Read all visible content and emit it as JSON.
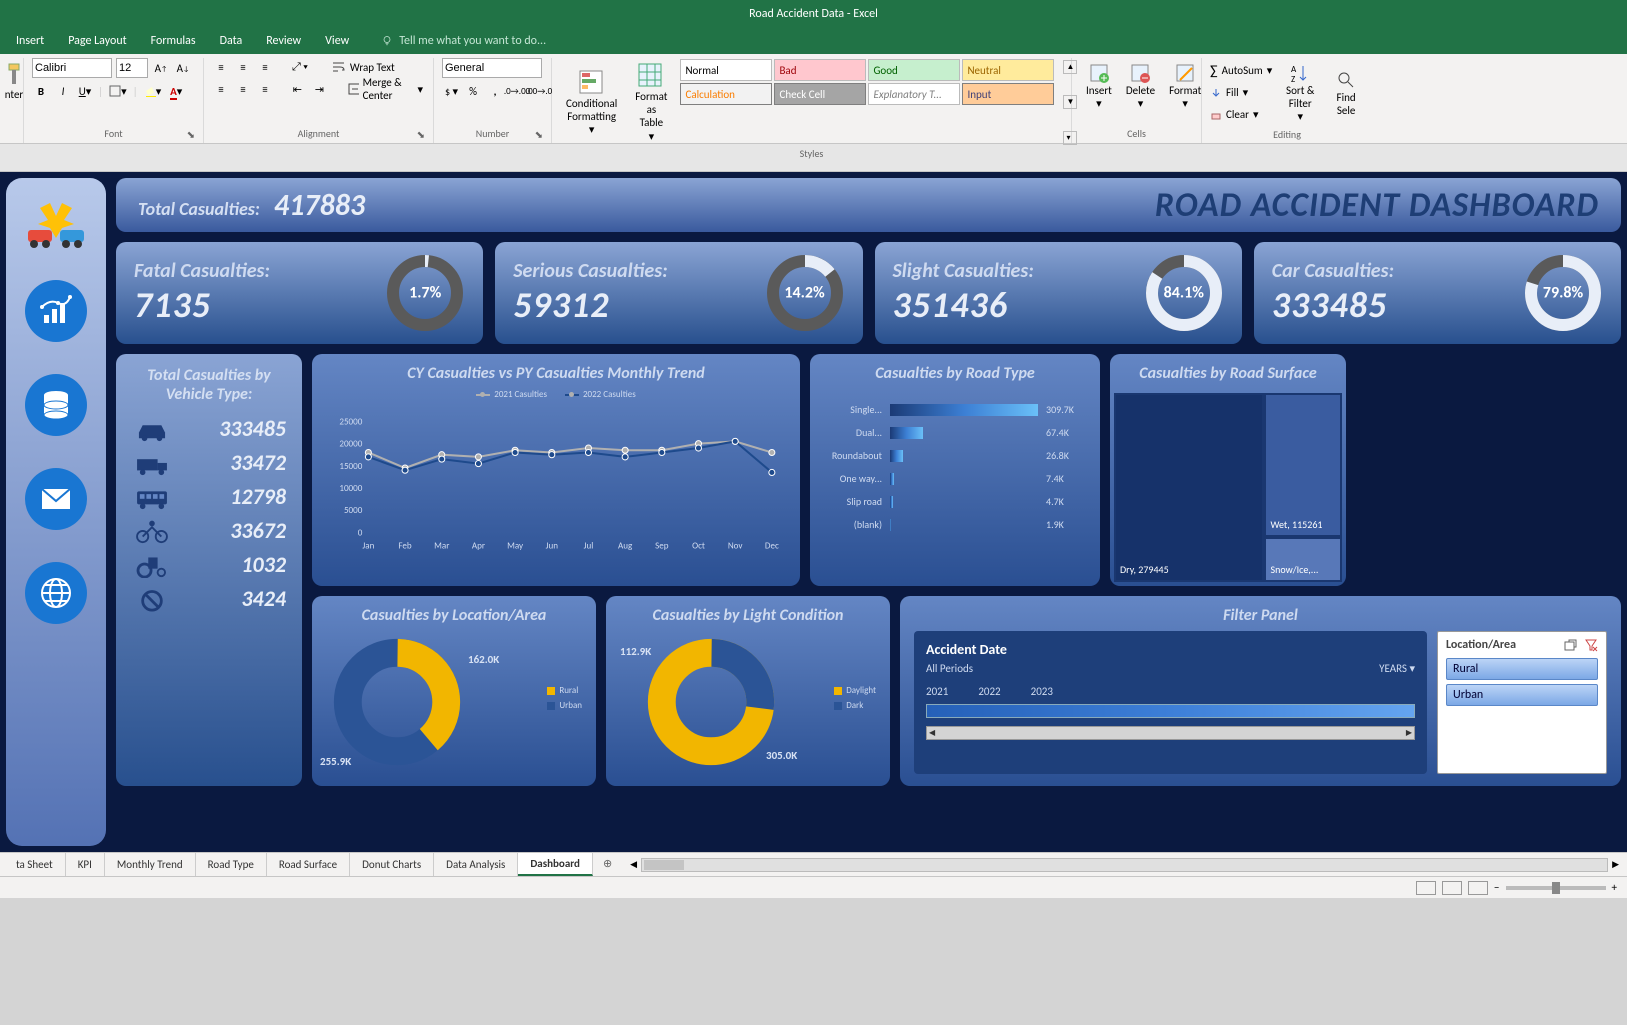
{
  "window_title": "Road Accident Data - Excel",
  "ribbon": {
    "tabs": [
      "Insert",
      "Page Layout",
      "Formulas",
      "Data",
      "Review",
      "View"
    ],
    "tellme": "Tell me what you want to do...",
    "font_name": "Calibri",
    "font_size": "12",
    "number_format": "General",
    "wrap_text": "Wrap Text",
    "merge_center": "Merge & Center",
    "painter_label": "nter",
    "conditional_formatting": "Conditional Formatting",
    "format_as_table": "Format as Table",
    "styles": {
      "normal": "Normal",
      "bad": "Bad",
      "good": "Good",
      "neutral": "Neutral",
      "calculation": "Calculation",
      "check_cell": "Check Cell",
      "explanatory": "Explanatory T...",
      "input": "Input"
    },
    "cells": {
      "insert": "Insert",
      "delete": "Delete",
      "format": "Format"
    },
    "editing": {
      "autosum": "AutoSum",
      "fill": "Fill",
      "clear": "Clear",
      "sort_filter": "Sort & Filter",
      "find_select": "Find Sele"
    },
    "groups": {
      "font": "Font",
      "alignment": "Alignment",
      "number": "Number",
      "styles": "Styles",
      "cells": "Cells",
      "editing": "Editing"
    }
  },
  "dashboard": {
    "total_label": "Total Casualties:",
    "total_value": "417883",
    "title": "ROAD ACCIDENT DASHBOARD",
    "kpis": [
      {
        "label": "Fatal Casualties:",
        "value": "7135",
        "pct": 1.7,
        "pct_label": "1.7%"
      },
      {
        "label": "Serious Casualties:",
        "value": "59312",
        "pct": 14.2,
        "pct_label": "14.2%"
      },
      {
        "label": "Slight Casualties:",
        "value": "351436",
        "pct": 84.1,
        "pct_label": "84.1%"
      },
      {
        "label": "Car Casualties:",
        "value": "333485",
        "pct": 79.8,
        "pct_label": "79.8%"
      }
    ],
    "vehicle": {
      "header": "Total Casualties by Vehicle Type:",
      "items": [
        {
          "icon": "car",
          "value": "333485"
        },
        {
          "icon": "truck",
          "value": "33472"
        },
        {
          "icon": "bus",
          "value": "12798"
        },
        {
          "icon": "bike",
          "value": "33672"
        },
        {
          "icon": "tractor",
          "value": "1032"
        },
        {
          "icon": "other",
          "value": "3424"
        }
      ]
    },
    "trend": {
      "title": "CY Casualties vs PY Casualties Monthly Trend",
      "series": [
        "2021 Casulties",
        "2022 Casulties"
      ]
    },
    "road_type": {
      "title": "Casualties by Road Type",
      "rows": [
        {
          "label": "Single...",
          "value": "309.7K",
          "w": 100
        },
        {
          "label": "Dual...",
          "value": "67.4K",
          "w": 22
        },
        {
          "label": "Roundabout",
          "value": "26.8K",
          "w": 9
        },
        {
          "label": "One way...",
          "value": "7.4K",
          "w": 3
        },
        {
          "label": "Slip road",
          "value": "4.7K",
          "w": 2
        },
        {
          "label": "(blank)",
          "value": "1.9K",
          "w": 1
        }
      ]
    },
    "surface": {
      "title": "Casualties by Road Surface",
      "dry": "Dry, 279445",
      "wet": "Wet, 115261",
      "snow": "Snow/Ice,..."
    },
    "location": {
      "title": "Casualties by Location/Area",
      "rural_label": "Rural",
      "urban_label": "Urban",
      "rural_val": "162.0K",
      "urban_val": "255.9K"
    },
    "light": {
      "title": "Casualties by Light Condition",
      "daylight_label": "Daylight",
      "dark_label": "Dark",
      "daylight_val": "305.0K",
      "dark_val": "112.9K"
    },
    "filter": {
      "title": "Filter Panel",
      "timeline_title": "Accident Date",
      "timeline_sub": "All Periods",
      "timeline_grp": "YEARS",
      "years": [
        "2021",
        "2022",
        "2023"
      ],
      "slicer_title": "Location/Area",
      "slicer_items": [
        "Rural",
        "Urban"
      ]
    }
  },
  "chart_data": {
    "trend": {
      "type": "line",
      "title": "CY Casualties vs PY Casualties Monthly Trend",
      "categories": [
        "Jan",
        "Feb",
        "Mar",
        "Apr",
        "May",
        "Jun",
        "Jul",
        "Aug",
        "Sep",
        "Oct",
        "Nov",
        "Dec"
      ],
      "series": [
        {
          "name": "2021 Casulties",
          "values": [
            18000,
            14500,
            17500,
            17000,
            18500,
            18000,
            19000,
            18500,
            18500,
            20000,
            20500,
            18000
          ]
        },
        {
          "name": "2022 Casulties",
          "values": [
            17000,
            14000,
            16500,
            15500,
            18000,
            17500,
            18000,
            17000,
            18000,
            19000,
            20500,
            13500
          ]
        }
      ],
      "ylim": [
        0,
        25000
      ],
      "yticks": [
        0,
        5000,
        10000,
        15000,
        20000,
        25000
      ]
    },
    "road_type_bars": {
      "type": "bar",
      "categories": [
        "Single carriageway",
        "Dual carriageway",
        "Roundabout",
        "One way street",
        "Slip road",
        "(blank)"
      ],
      "values": [
        309700,
        67400,
        26800,
        7400,
        4700,
        1900
      ]
    },
    "surface_treemap": {
      "type": "treemap",
      "items": [
        {
          "label": "Dry",
          "value": 279445
        },
        {
          "label": "Wet",
          "value": 115261
        },
        {
          "label": "Snow/Ice",
          "value": 23177
        }
      ]
    },
    "location_pie": {
      "type": "pie",
      "slices": [
        {
          "label": "Rural",
          "value": 162000
        },
        {
          "label": "Urban",
          "value": 255900
        }
      ]
    },
    "light_pie": {
      "type": "pie",
      "slices": [
        {
          "label": "Daylight",
          "value": 305000
        },
        {
          "label": "Dark",
          "value": 112900
        }
      ]
    },
    "kpi_donuts": [
      {
        "label": "Fatal",
        "pct": 1.7
      },
      {
        "label": "Serious",
        "pct": 14.2
      },
      {
        "label": "Slight",
        "pct": 84.1
      },
      {
        "label": "Car",
        "pct": 79.8
      }
    ]
  },
  "sheet_tabs": [
    "ta Sheet",
    "KPI",
    "Monthly Trend",
    "Road Type",
    "Road Surface",
    "Donut Charts",
    "Data Analysis",
    "Dashboard"
  ],
  "active_sheet": "Dashboard"
}
